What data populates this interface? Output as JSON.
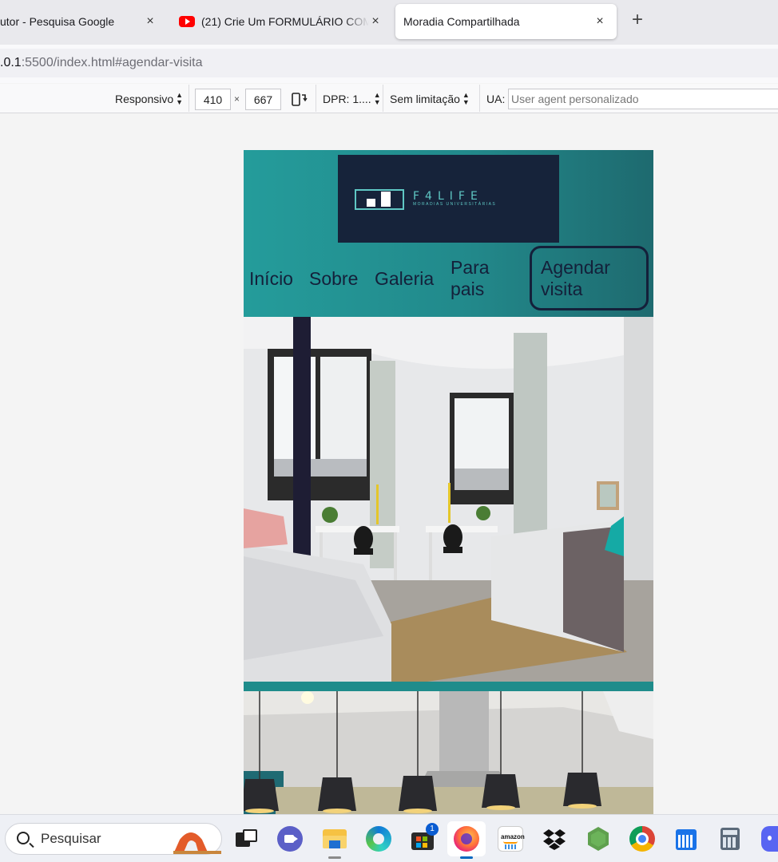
{
  "browser": {
    "tabs": [
      {
        "title": "utor - Pesquisa Google",
        "close": "×"
      },
      {
        "title": "(21) Crie Um FORMULÁRIO COM",
        "close": "×"
      },
      {
        "title": "Moradia Compartilhada",
        "close": "×"
      }
    ],
    "new_tab": "+",
    "url_host": ".0.1",
    "url_rest": ":5500/index.html#agendar-visita"
  },
  "rdm_toolbar": {
    "device": "Responsivo",
    "width": "410",
    "times": "×",
    "height": "667",
    "dpr": "DPR: 1....",
    "throttling": "Sem limitação",
    "ua_label": "UA:",
    "ua_placeholder": "User agent personalizado"
  },
  "site": {
    "logo": {
      "brand": "F4LIFE",
      "tagline": "MORADIAS UNIVERSITÁRIAS"
    },
    "nav": [
      {
        "label": "Início"
      },
      {
        "label": "Sobre"
      },
      {
        "label": "Galeria"
      },
      {
        "label": "Para pais"
      },
      {
        "label": "Agendar visita"
      }
    ],
    "colors": {
      "header_start": "#249c9b",
      "header_end": "#1e6a6f",
      "nav_text": "#14203a",
      "logo_bg": "#16233a",
      "logo_accent": "#5fc7c4"
    }
  },
  "taskbar": {
    "search_placeholder": "Pesquisar",
    "store_badge": "1",
    "icons": [
      "landscape-widget-icon",
      "task-view-icon",
      "meet-icon",
      "file-explorer-icon",
      "edge-icon",
      "microsoft-store-icon",
      "firefox-icon",
      "amazon-icon",
      "dropbox-icon",
      "nodejs-icon",
      "chrome-icon",
      "calendar-icon",
      "calculator-icon",
      "discord-icon"
    ]
  }
}
